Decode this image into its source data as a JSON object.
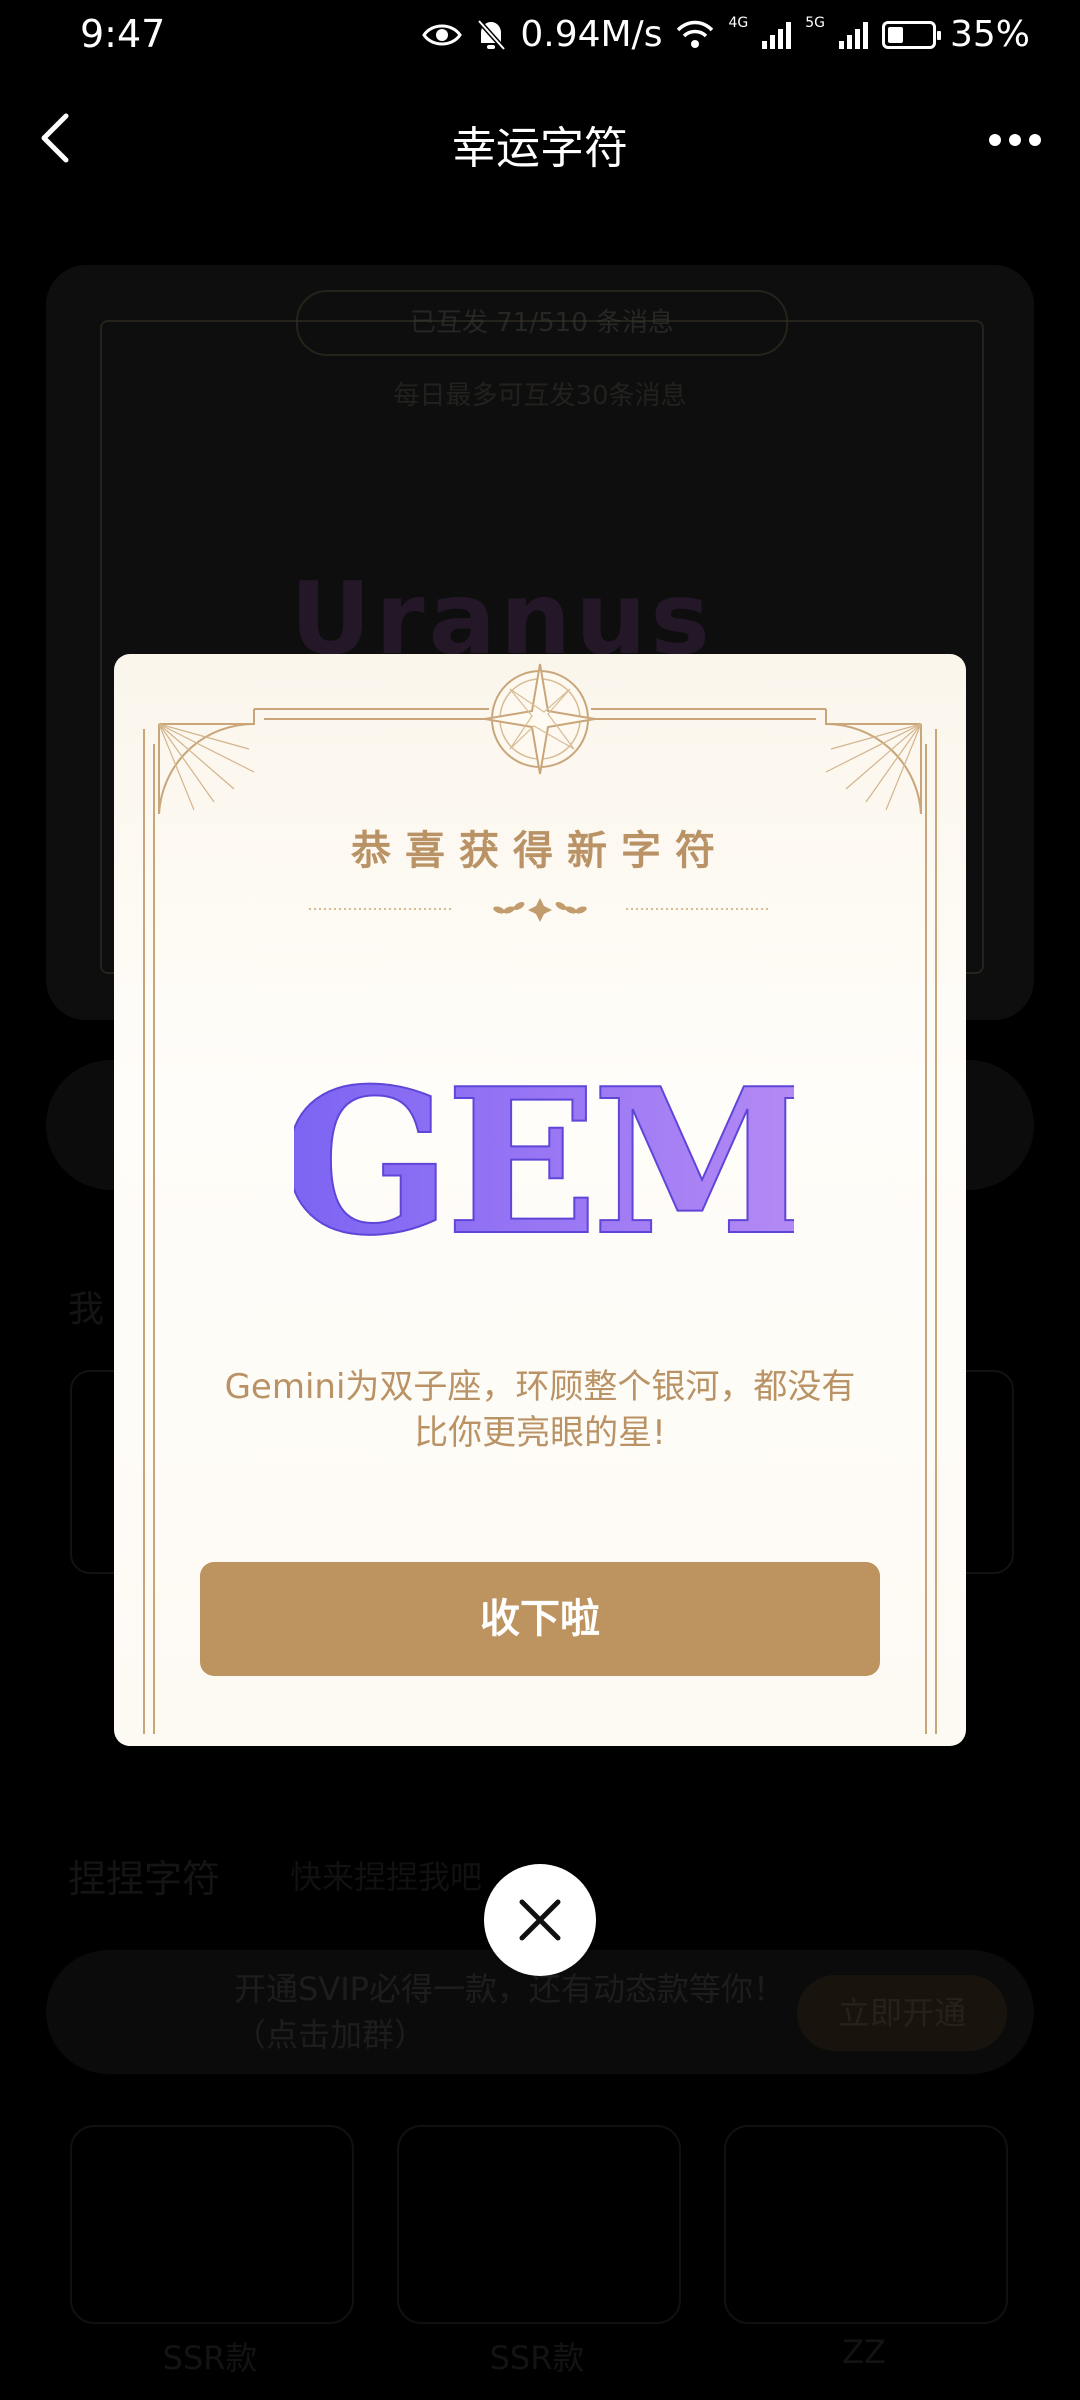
{
  "status_bar": {
    "time": "9:47",
    "net_speed": "0.94M/s",
    "net_4g": "4G",
    "net_5g": "5G",
    "battery": "35%",
    "battery_level": 0.35
  },
  "header": {
    "title": "幸运字符",
    "back_icon": "chevron-left-icon",
    "more_icon": "more-horizontal-icon"
  },
  "background": {
    "interaction_count": "已互发 71/510 条消息",
    "daily_limit": "每日最多可互发30条消息",
    "main_logo": "Uranus",
    "section_mine": "我",
    "section_pinch": "捏捏字符",
    "section_pinch_sub": "快来捏捏我吧",
    "vip_text": "开通SVIP必得一款，还有动态款等你！（点击加群）",
    "vip_button": "立即开通",
    "cards": [
      {
        "label": "SSR款"
      },
      {
        "label": "SSR款"
      },
      {
        "label": "ZZ"
      }
    ]
  },
  "modal": {
    "title": "恭喜获得新字符",
    "word": "GEM",
    "description": "Gemini为双子座，环顾整个银河，都没有比你更亮眼的星!",
    "confirm_button": "收下啦",
    "accent_color": "#bd945f",
    "gradient_start": "#7b63f3",
    "gradient_end": "#b58af4"
  },
  "close_icon": "close-icon"
}
